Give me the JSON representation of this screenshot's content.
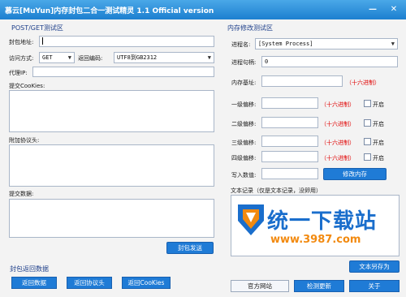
{
  "window": {
    "title": "慕云[MuYun]内存封包二合一测试精灵 1.1 Official version",
    "minimize_glyph": "—",
    "close_glyph": "✕"
  },
  "left": {
    "section_title": "POST/GET测试区",
    "url_label": "封包地址:",
    "url_value": "",
    "method_label": "访问方式:",
    "method_value": "GET",
    "encoding_label": "返回编码:",
    "encoding_value": "UTF8到GB2312",
    "proxy_label": "代理IP:",
    "proxy_value": "",
    "cookies_label": "提交CooKies:",
    "headers_label": "附加协议头:",
    "postdata_label": "提交数据:",
    "send_button": "封包发送",
    "return_section_title": "封包返回数据",
    "btn_return_data": "返回数据",
    "btn_return_headers": "返回协议头",
    "btn_return_cookies": "返回CooKies"
  },
  "right": {
    "section_title": "内存修改测试区",
    "process_label": "进程名:",
    "process_value": "[System Process]",
    "handle_label": "进程句柄:",
    "handle_value": "0",
    "base_label": "内存基址:",
    "base_value": "",
    "hex_note": "（十六进制）",
    "offsets": [
      {
        "label": "一级偏移:",
        "value": "",
        "note": "（十六进制）",
        "open_label": "开启"
      },
      {
        "label": "二级偏移:",
        "value": "",
        "note": "（十六进制）",
        "open_label": "开启"
      },
      {
        "label": "三级偏移:",
        "value": "",
        "note": "（十六进制）",
        "open_label": "开启"
      },
      {
        "label": "四级偏移:",
        "value": "",
        "note": "（十六进制）",
        "open_label": "开启"
      }
    ],
    "write_label": "写入数值:",
    "write_value": "",
    "modify_button": "修改内存",
    "log_label": "文本记录（仅是文本记录，没卵用）",
    "save_as_button": "文本另存为",
    "btn_website": "官方网站",
    "btn_update": "检测更新",
    "btn_about": "关于"
  },
  "watermark": {
    "title": "统一下载站",
    "url": "www.3987.com"
  },
  "colors": {
    "titlebar": "#1c7fd0",
    "button": "#1f7bd6",
    "hex_note": "#e00000",
    "logo_blue": "#1a6ecc",
    "logo_orange": "#f28a10"
  }
}
